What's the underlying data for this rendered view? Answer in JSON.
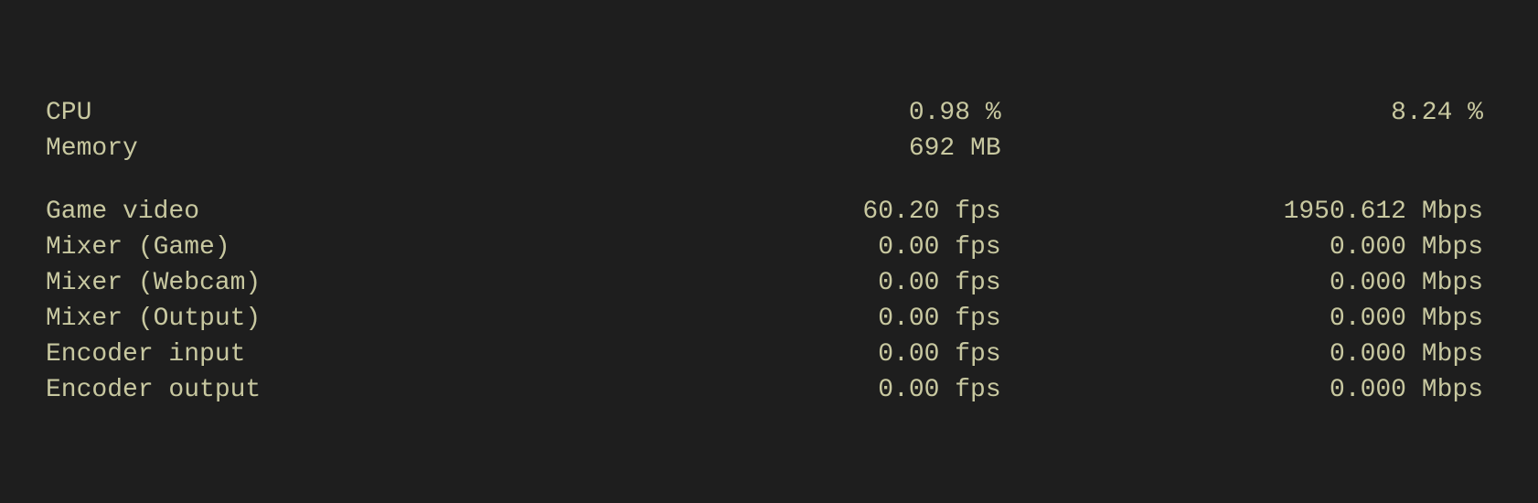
{
  "rows": [
    {
      "id": "cpu",
      "label": "CPU",
      "value1": "0.98 %",
      "value2": "8.24 %"
    },
    {
      "id": "memory",
      "label": "Memory",
      "value1": "692 MB",
      "value2": ""
    },
    {
      "id": "spacer",
      "label": "",
      "value1": "",
      "value2": ""
    },
    {
      "id": "game-video",
      "label": "Game video",
      "value1": "60.20 fps",
      "value2": "1950.612 Mbps"
    },
    {
      "id": "mixer-game",
      "label": "Mixer (Game)",
      "value1": "0.00 fps",
      "value2": "0.000 Mbps"
    },
    {
      "id": "mixer-webcam",
      "label": "Mixer (Webcam)",
      "value1": "0.00 fps",
      "value2": "0.000 Mbps"
    },
    {
      "id": "mixer-output",
      "label": "Mixer (Output)",
      "value1": "0.00 fps",
      "value2": "0.000 Mbps"
    },
    {
      "id": "encoder-input",
      "label": "Encoder input",
      "value1": "0.00 fps",
      "value2": "0.000 Mbps"
    },
    {
      "id": "encoder-output",
      "label": "Encoder output",
      "value1": "0.00 fps",
      "value2": "0.000 Mbps"
    }
  ]
}
